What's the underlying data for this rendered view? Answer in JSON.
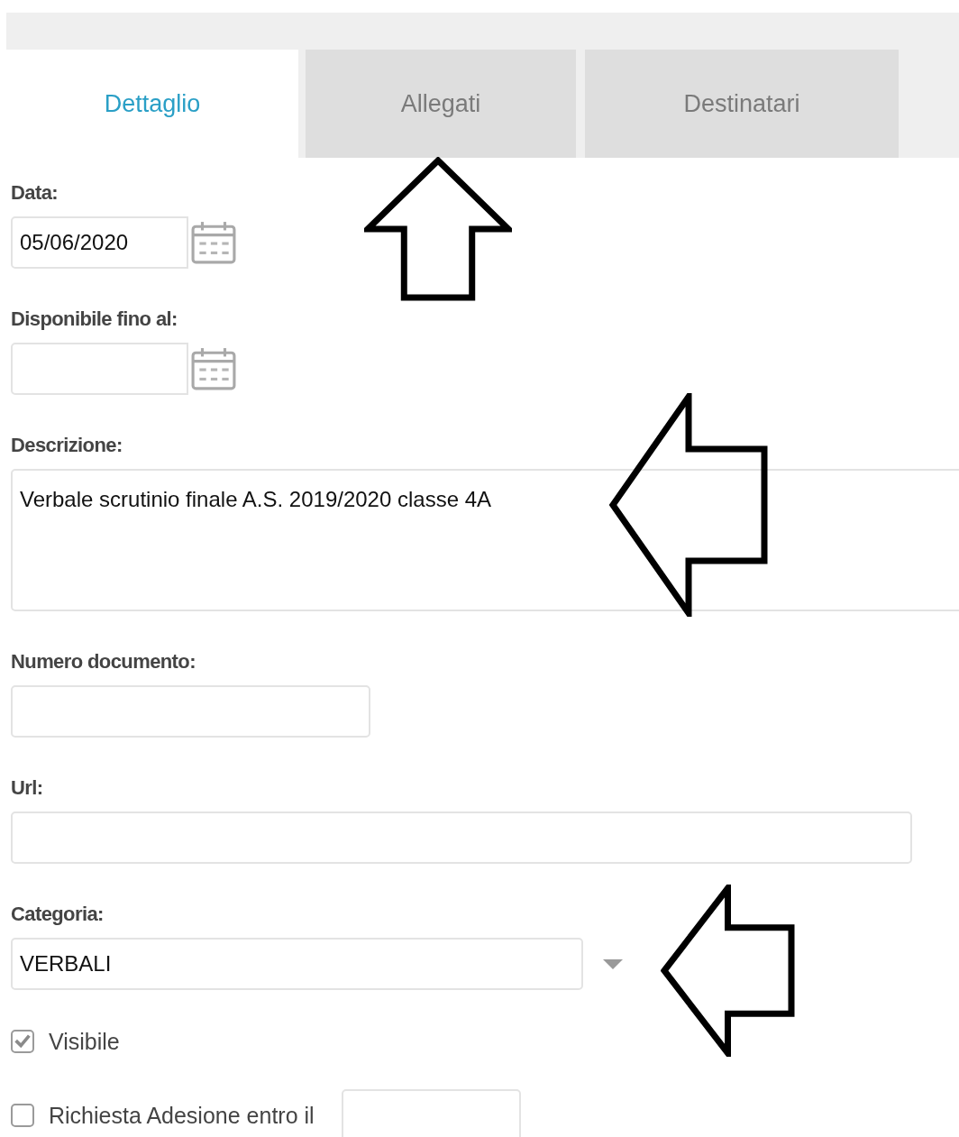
{
  "tabs": [
    {
      "label": "Dettaglio",
      "selected": true
    },
    {
      "label": "Allegati",
      "selected": false
    },
    {
      "label": "Destinatari",
      "selected": false
    }
  ],
  "fields": [
    {
      "kind": "date",
      "label": "Data:",
      "value": "05/06/2020"
    },
    {
      "kind": "date",
      "label": "Disponibile fino al:"
    },
    {
      "kind": "textarea",
      "label": "Descrizione:",
      "value": "Verbale scrutinio finale A.S. 2019/2020 classe 4A"
    },
    {
      "kind": "short-text",
      "label": "Numero documento:"
    },
    {
      "kind": "text",
      "label": "Url:"
    },
    {
      "kind": "select",
      "label": "Categoria:",
      "value": "VERBALI"
    }
  ],
  "checkboxes": [
    {
      "label": "Visibile",
      "checked": true,
      "date_field": false
    },
    {
      "label": "Richiesta Adesione entro il",
      "checked": false,
      "date_field": true
    }
  ],
  "annotations": [
    {
      "kind": "up-arrow"
    },
    {
      "kind": "left-arrow"
    },
    {
      "kind": "left-arrow"
    }
  ]
}
